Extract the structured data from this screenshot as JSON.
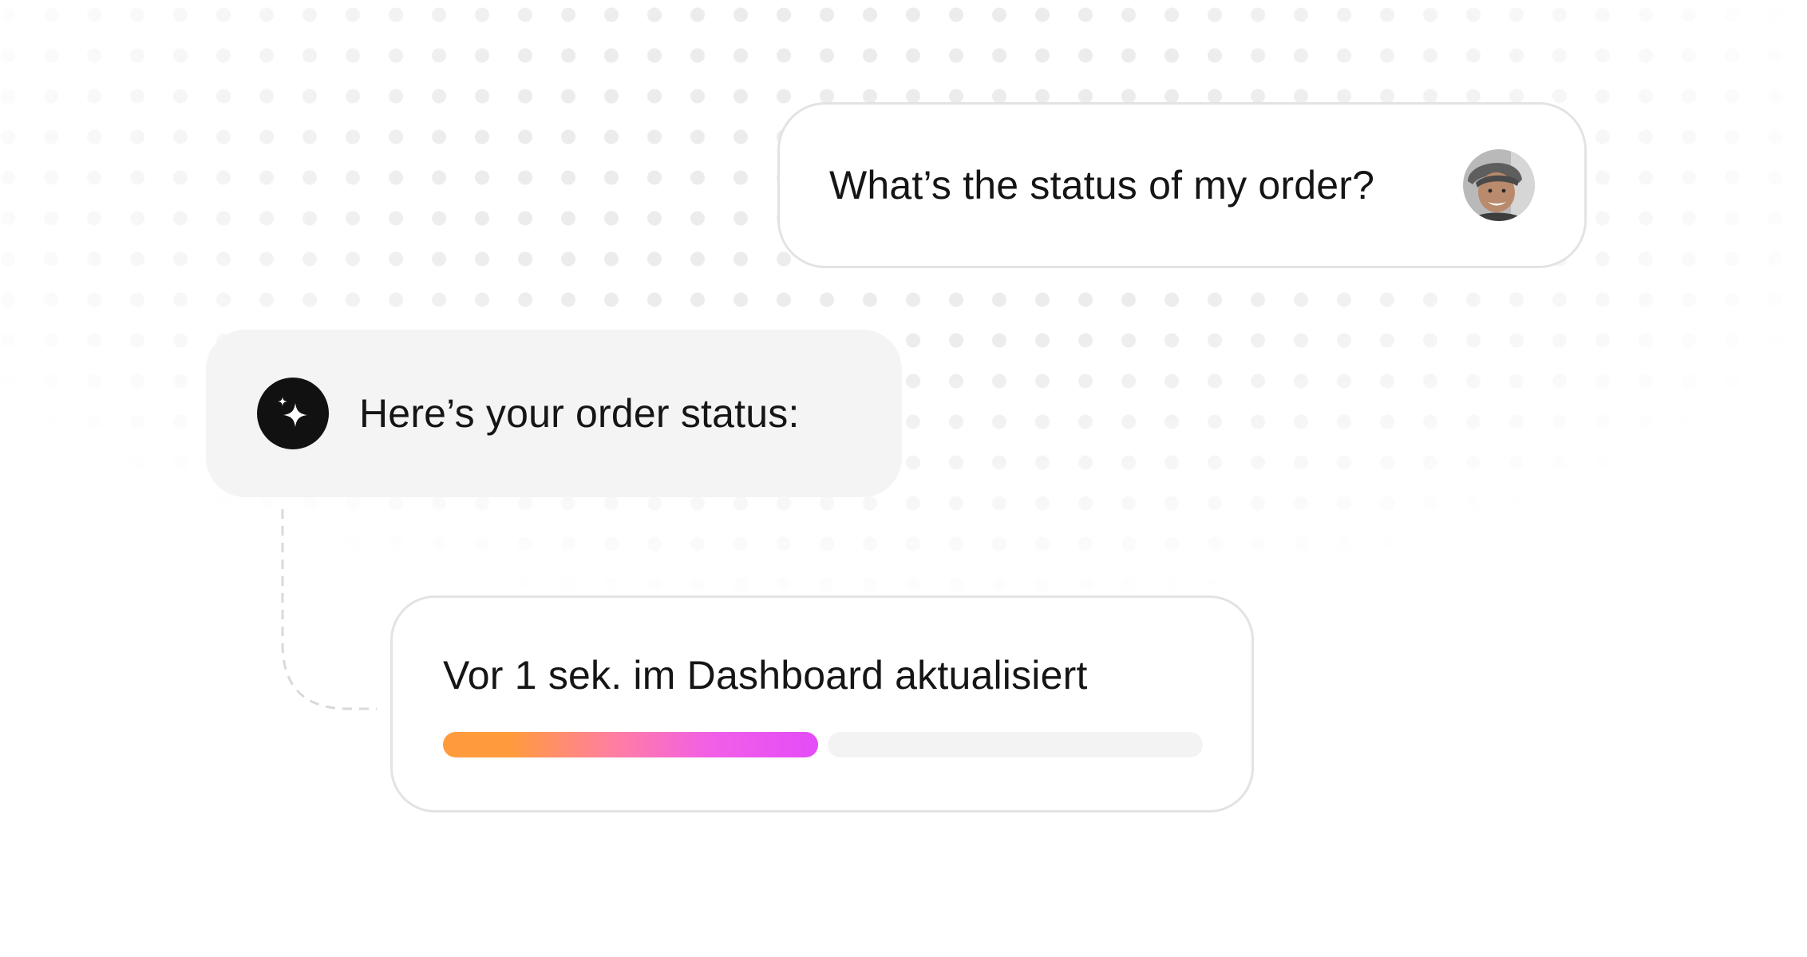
{
  "conversation": {
    "user_message": "What’s the status of my order?",
    "assistant_message": "Here’s your order status:"
  },
  "status_card": {
    "text": "Vor 1 sek. im Dashboard aktualisiert",
    "progress": 0.5
  },
  "icons": {
    "assistant": "sparkle-icon",
    "user": "user-avatar"
  },
  "colors": {
    "gradient_start": "#ff9b3d",
    "gradient_end": "#e44cf7",
    "assistant_icon_bg": "#111111"
  }
}
